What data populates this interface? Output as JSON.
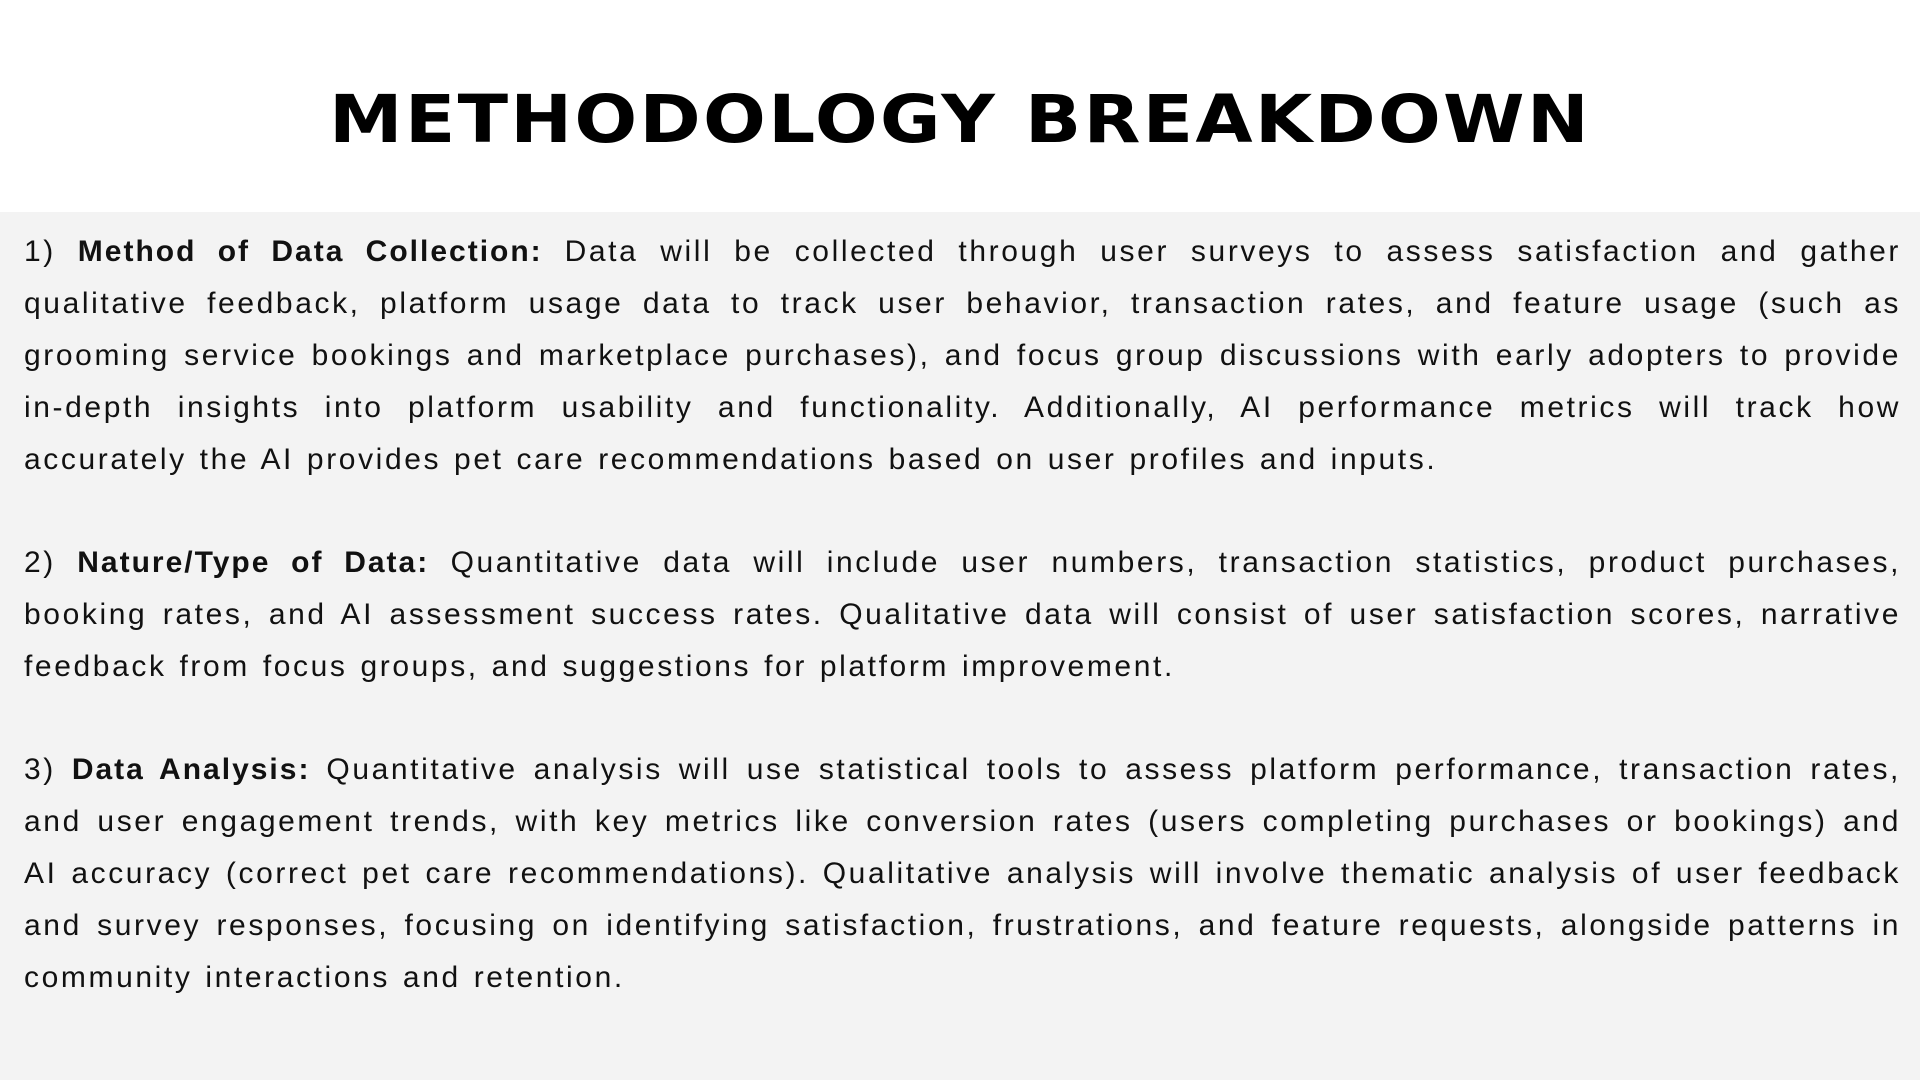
{
  "page": {
    "title": "METHODOLOGY BREAKDOWN"
  },
  "sections": [
    {
      "number": "1)",
      "heading": "Method of Data Collection:",
      "body": "Data will be collected through user surveys to assess satisfaction and gather qualitative feedback, platform usage data to track user behavior, transaction rates, and feature usage (such as grooming service bookings and marketplace purchases), and focus group discussions with early adopters to provide in-depth insights into platform usability and functionality. Additionally, AI performance metrics will track how accurately the AI provides pet care recommendations based on user profiles and inputs."
    },
    {
      "number": "2)",
      "heading": "Nature/Type of Data:",
      "body": "Quantitative data will include user numbers, transaction statistics, product purchases, booking rates, and AI assessment success rates. Qualitative data will consist of user satisfaction scores, narrative feedback from focus groups, and suggestions for platform improvement."
    },
    {
      "number": "3)",
      "heading": "Data Analysis:",
      "body": "Quantitative analysis will use statistical tools to assess platform performance, transaction rates, and user engagement trends, with key metrics like conversion rates (users completing purchases or bookings) and AI accuracy (correct pet care recommendations). Qualitative analysis will involve thematic analysis of user feedback and survey responses, focusing on identifying satisfaction, frustrations, and feature requests, alongside patterns in community interactions and retention."
    }
  ]
}
